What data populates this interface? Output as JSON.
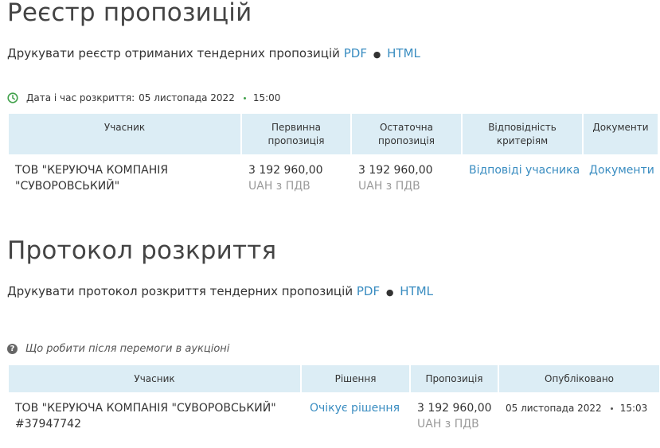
{
  "registry": {
    "title": "Реєстр пропозицій",
    "print_text": "Друкувати реєстр отриманих тендерних пропозицій",
    "pdf_label": "PDF",
    "html_label": "HTML",
    "bullet": "●",
    "opening_label": "Дата і час розкриття:",
    "opening_date": "05 листопада 2022",
    "opening_time": "15:00",
    "columns": {
      "participant": "Учасник",
      "initial_offer": "Первинна пропозиція",
      "final_offer": "Остаточна пропозиція",
      "criteria": "Відповідність критеріям",
      "documents": "Документи"
    },
    "rows": [
      {
        "participant": "ТОВ \"КЕРУЮЧА КОМПАНІЯ \"СУВОРОВСЬКИЙ\"",
        "initial_amount": "3 192 960,00",
        "initial_currency": "UAH з ПДВ",
        "final_amount": "3 192 960,00",
        "final_currency": "UAH з ПДВ",
        "criteria_link": "Відповіді учасника",
        "documents_link": "Документи"
      }
    ]
  },
  "protocol": {
    "title": "Протокол розкриття",
    "print_text": "Друкувати протокол розкриття тендерних пропозицій",
    "pdf_label": "PDF",
    "html_label": "HTML",
    "bullet": "●",
    "help_link": "Що робити після перемоги в аукціоні",
    "columns": {
      "participant": "Учасник",
      "decision": "Рішення",
      "offer": "Пропозиція",
      "published": "Опубліковано"
    },
    "rows": [
      {
        "participant_name": "ТОВ \"КЕРУЮЧА КОМПАНІЯ \"СУВОРОВСЬКИЙ\"",
        "participant_id": "#37947742",
        "decision": "Очікує рішення",
        "offer_amount": "3 192 960,00",
        "offer_currency": "UAH з ПДВ",
        "published_date": "05 листопада 2022",
        "published_time": "15:03"
      }
    ]
  },
  "colors": {
    "link": "#3a8dc1",
    "header_bg": "#dcedf5",
    "clock": "#41a14b",
    "muted": "#9a9a9a"
  },
  "icons": {
    "clock": "clock-icon",
    "help": "question-circle-icon"
  }
}
